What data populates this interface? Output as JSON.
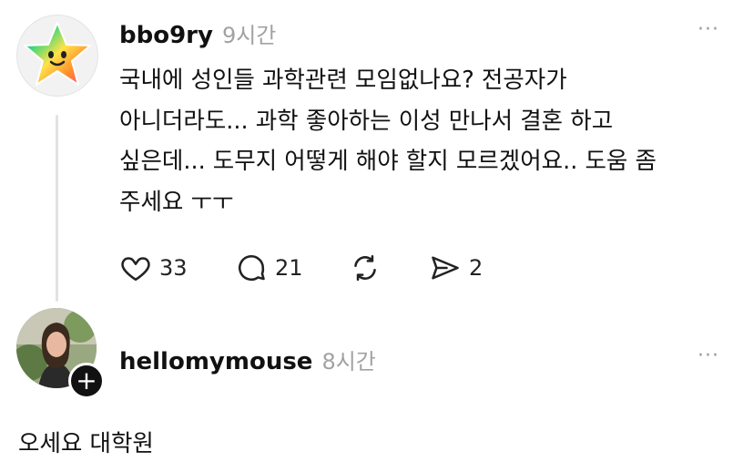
{
  "post": {
    "username": "bbo9ry",
    "time": "9시간",
    "more": "···",
    "lines": [
      "국내에 성인들 과학관련 모임없나요? 전공자가",
      "아니더라도... 과학 좋아하는 이성 만나서 결혼 하고",
      "싶은데... 도무지 어떻게 해야 할지 모르겠어요.. 도움 좀",
      "주세요 ㅜㅜ"
    ],
    "actions": {
      "likes": "33",
      "comments": "21",
      "shares": "2"
    }
  },
  "reply": {
    "username": "hellomymouse",
    "time": "8시간",
    "more": "···",
    "text": "오세요 대학원",
    "follow_icon": "+"
  }
}
